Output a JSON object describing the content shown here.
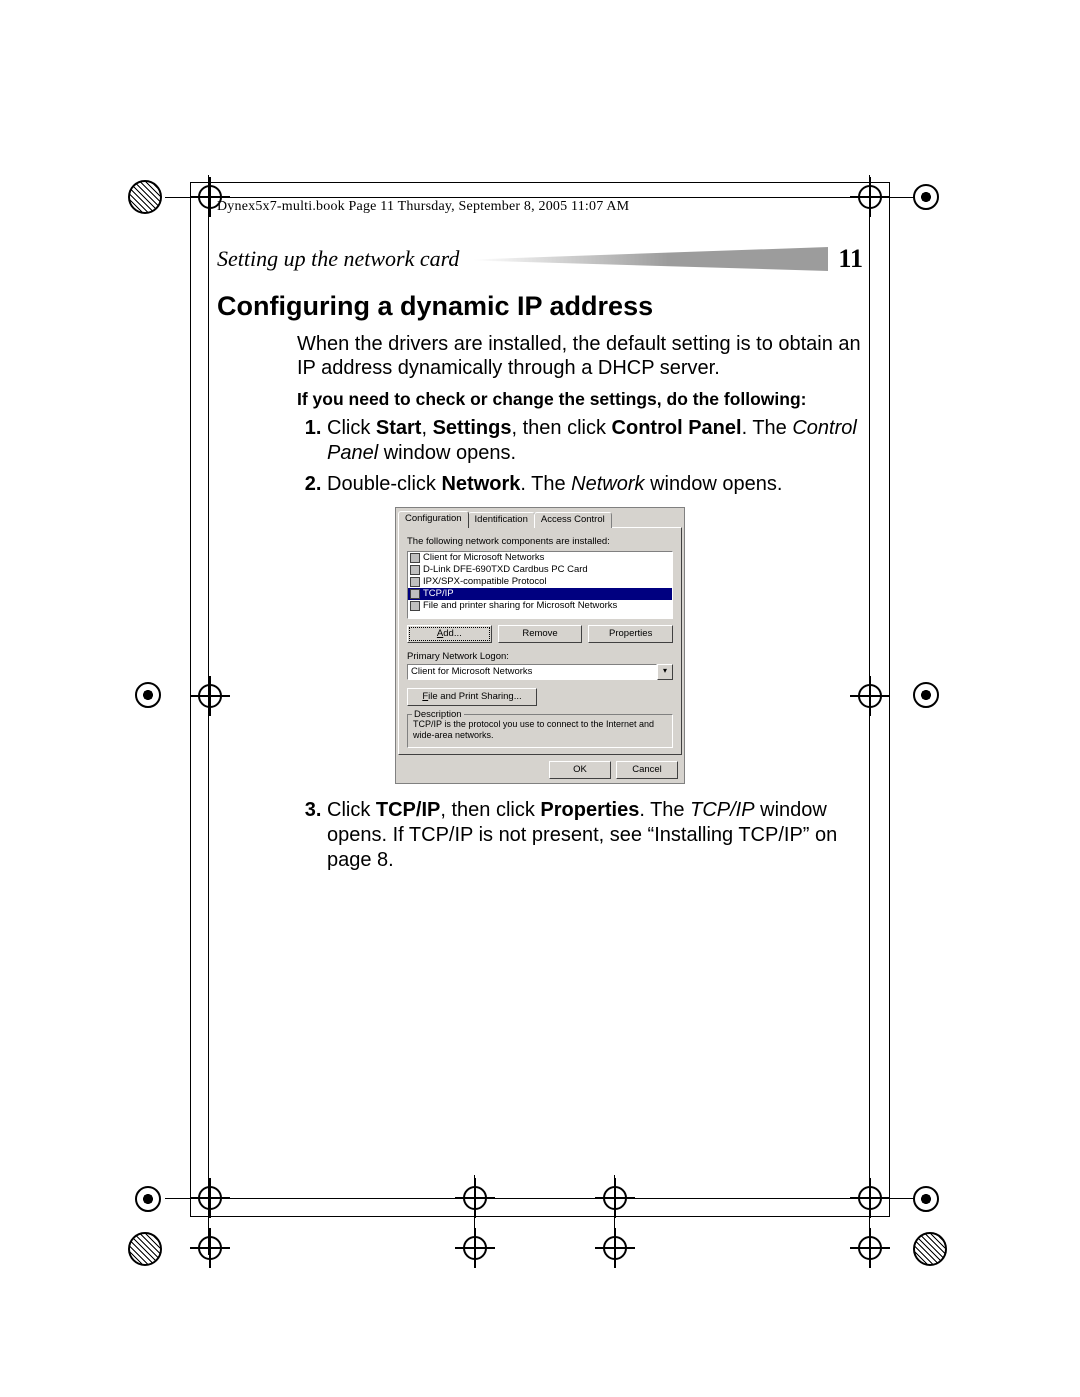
{
  "meta": {
    "line": "Dynex5x7-multi.book  Page 11  Thursday, September 8, 2005  11:07 AM"
  },
  "header": {
    "section": "Setting up the network card",
    "page": "11"
  },
  "heading": "Configuring a dynamic IP address",
  "intro": "When the drivers are installed, the default setting is to obtain an IP address dynamically through a DHCP server.",
  "subheading": "If you need to check or change the settings, do the following:",
  "steps": {
    "s1_a": "Click ",
    "s1_b1": "Start",
    "s1_c": ", ",
    "s1_b2": "Settings",
    "s1_d": ", then click ",
    "s1_b3": "Control Panel",
    "s1_e": ". The ",
    "s1_i": "Control Panel",
    "s1_f": " window opens.",
    "s2_a": "Double-click ",
    "s2_b": "Network",
    "s2_c": ". The ",
    "s2_i": "Network",
    "s2_d": " window opens.",
    "s3_a": "Click ",
    "s3_b1": "TCP/IP",
    "s3_c": ", then click ",
    "s3_b2": "Properties",
    "s3_d": ". The ",
    "s3_i": "TCP/IP",
    "s3_e": " window opens. If TCP/IP is not present, see “Installing TCP/IP” on page 8."
  },
  "dialog": {
    "tabs": {
      "configuration": "Configuration",
      "identification": "Identification",
      "access": "Access Control"
    },
    "installed_label": "The following network components are installed:",
    "components": [
      "Client for Microsoft Networks",
      "D-Link DFE-690TXD Cardbus PC Card",
      "IPX/SPX-compatible Protocol",
      "TCP/IP",
      "File and printer sharing for Microsoft Networks"
    ],
    "buttons": {
      "add": "Add...",
      "remove": "Remove",
      "properties": "Properties"
    },
    "logon_label": "Primary Network Logon:",
    "logon_value": "Client for Microsoft Networks",
    "share_btn": "File and Print Sharing...",
    "desc_legend": "Description",
    "desc_text": "TCP/IP is the protocol you use to connect to the Internet and wide-area networks.",
    "ok": "OK",
    "cancel": "Cancel"
  }
}
